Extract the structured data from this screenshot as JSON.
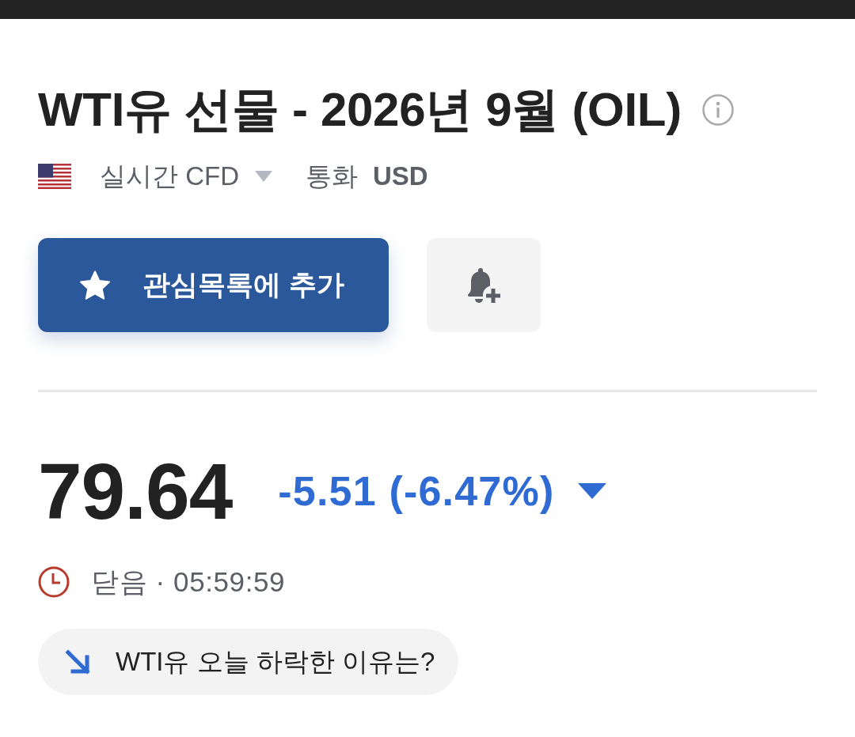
{
  "instrument": {
    "title": "WTI유 선물 - 2026년 9월 (OIL)",
    "market": "실시간 CFD",
    "currency_label": "통화",
    "currency": "USD"
  },
  "actions": {
    "watchlist_button": "관심목록에 추가"
  },
  "quote": {
    "price": "79.64",
    "change": "-5.51 (-6.47%)",
    "falling": true,
    "status": "닫음 · 05:59:59"
  },
  "insight": {
    "question": "WTI유 오늘 하락한 이유는?"
  }
}
